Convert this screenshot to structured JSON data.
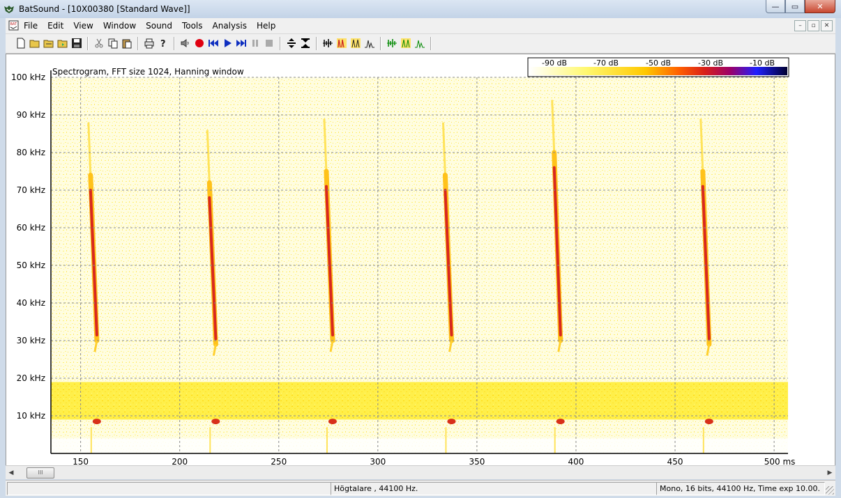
{
  "window": {
    "title": "BatSound - [10X00380 [Standard Wave]]",
    "min_symbol": "—",
    "max_symbol": "▭",
    "close_symbol": "✕"
  },
  "menu": [
    "File",
    "Edit",
    "View",
    "Window",
    "Sound",
    "Tools",
    "Analysis",
    "Help"
  ],
  "plot": {
    "title": "Spectrogram, FFT size 1024, Hanning window",
    "color_scale_labels": [
      "-90 dB",
      "-70 dB",
      "-50 dB",
      "-30 dB",
      "-10 dB"
    ],
    "y_labels": [
      "100 kHz",
      "90 kHz",
      "80 kHz",
      "70 kHz",
      "60 kHz",
      "50 kHz",
      "40 kHz",
      "30 kHz",
      "20 kHz",
      "10 kHz"
    ],
    "x_labels": [
      "150",
      "200",
      "250",
      "300",
      "350",
      "400",
      "450",
      "500 ms"
    ]
  },
  "chart_data": {
    "type": "heatmap",
    "title": "Spectrogram, FFT size 1024, Hanning window",
    "xlim_ms": [
      135,
      507
    ],
    "ylim_khz": [
      0,
      100
    ],
    "x_ticks": [
      150,
      200,
      250,
      300,
      350,
      400,
      450,
      500
    ],
    "y_ticks": [
      10,
      20,
      30,
      40,
      50,
      60,
      70,
      80,
      90,
      100
    ],
    "color_scale_db": [
      -90,
      -70,
      -50,
      -30,
      -10
    ],
    "noise_band_khz": [
      9,
      19
    ],
    "calls": [
      {
        "time_ms": 155,
        "f_start_khz": 74,
        "f_end_khz": 30
      },
      {
        "time_ms": 215,
        "f_start_khz": 72,
        "f_end_khz": 29
      },
      {
        "time_ms": 274,
        "f_start_khz": 75,
        "f_end_khz": 30
      },
      {
        "time_ms": 334,
        "f_start_khz": 74,
        "f_end_khz": 30
      },
      {
        "time_ms": 389,
        "f_start_khz": 80,
        "f_end_khz": 30
      },
      {
        "time_ms": 464,
        "f_start_khz": 75,
        "f_end_khz": 29
      }
    ],
    "low_tone_khz": 8.5
  },
  "status": {
    "output": "Högtalare ,  44100 Hz.",
    "format": "Mono, 16 bits, 44100 Hz, Time exp 10.00."
  },
  "scroll_thumb_text": "III",
  "colors": {
    "noise": "#ffff60",
    "call": "#d8281f",
    "axis": "#000000"
  }
}
